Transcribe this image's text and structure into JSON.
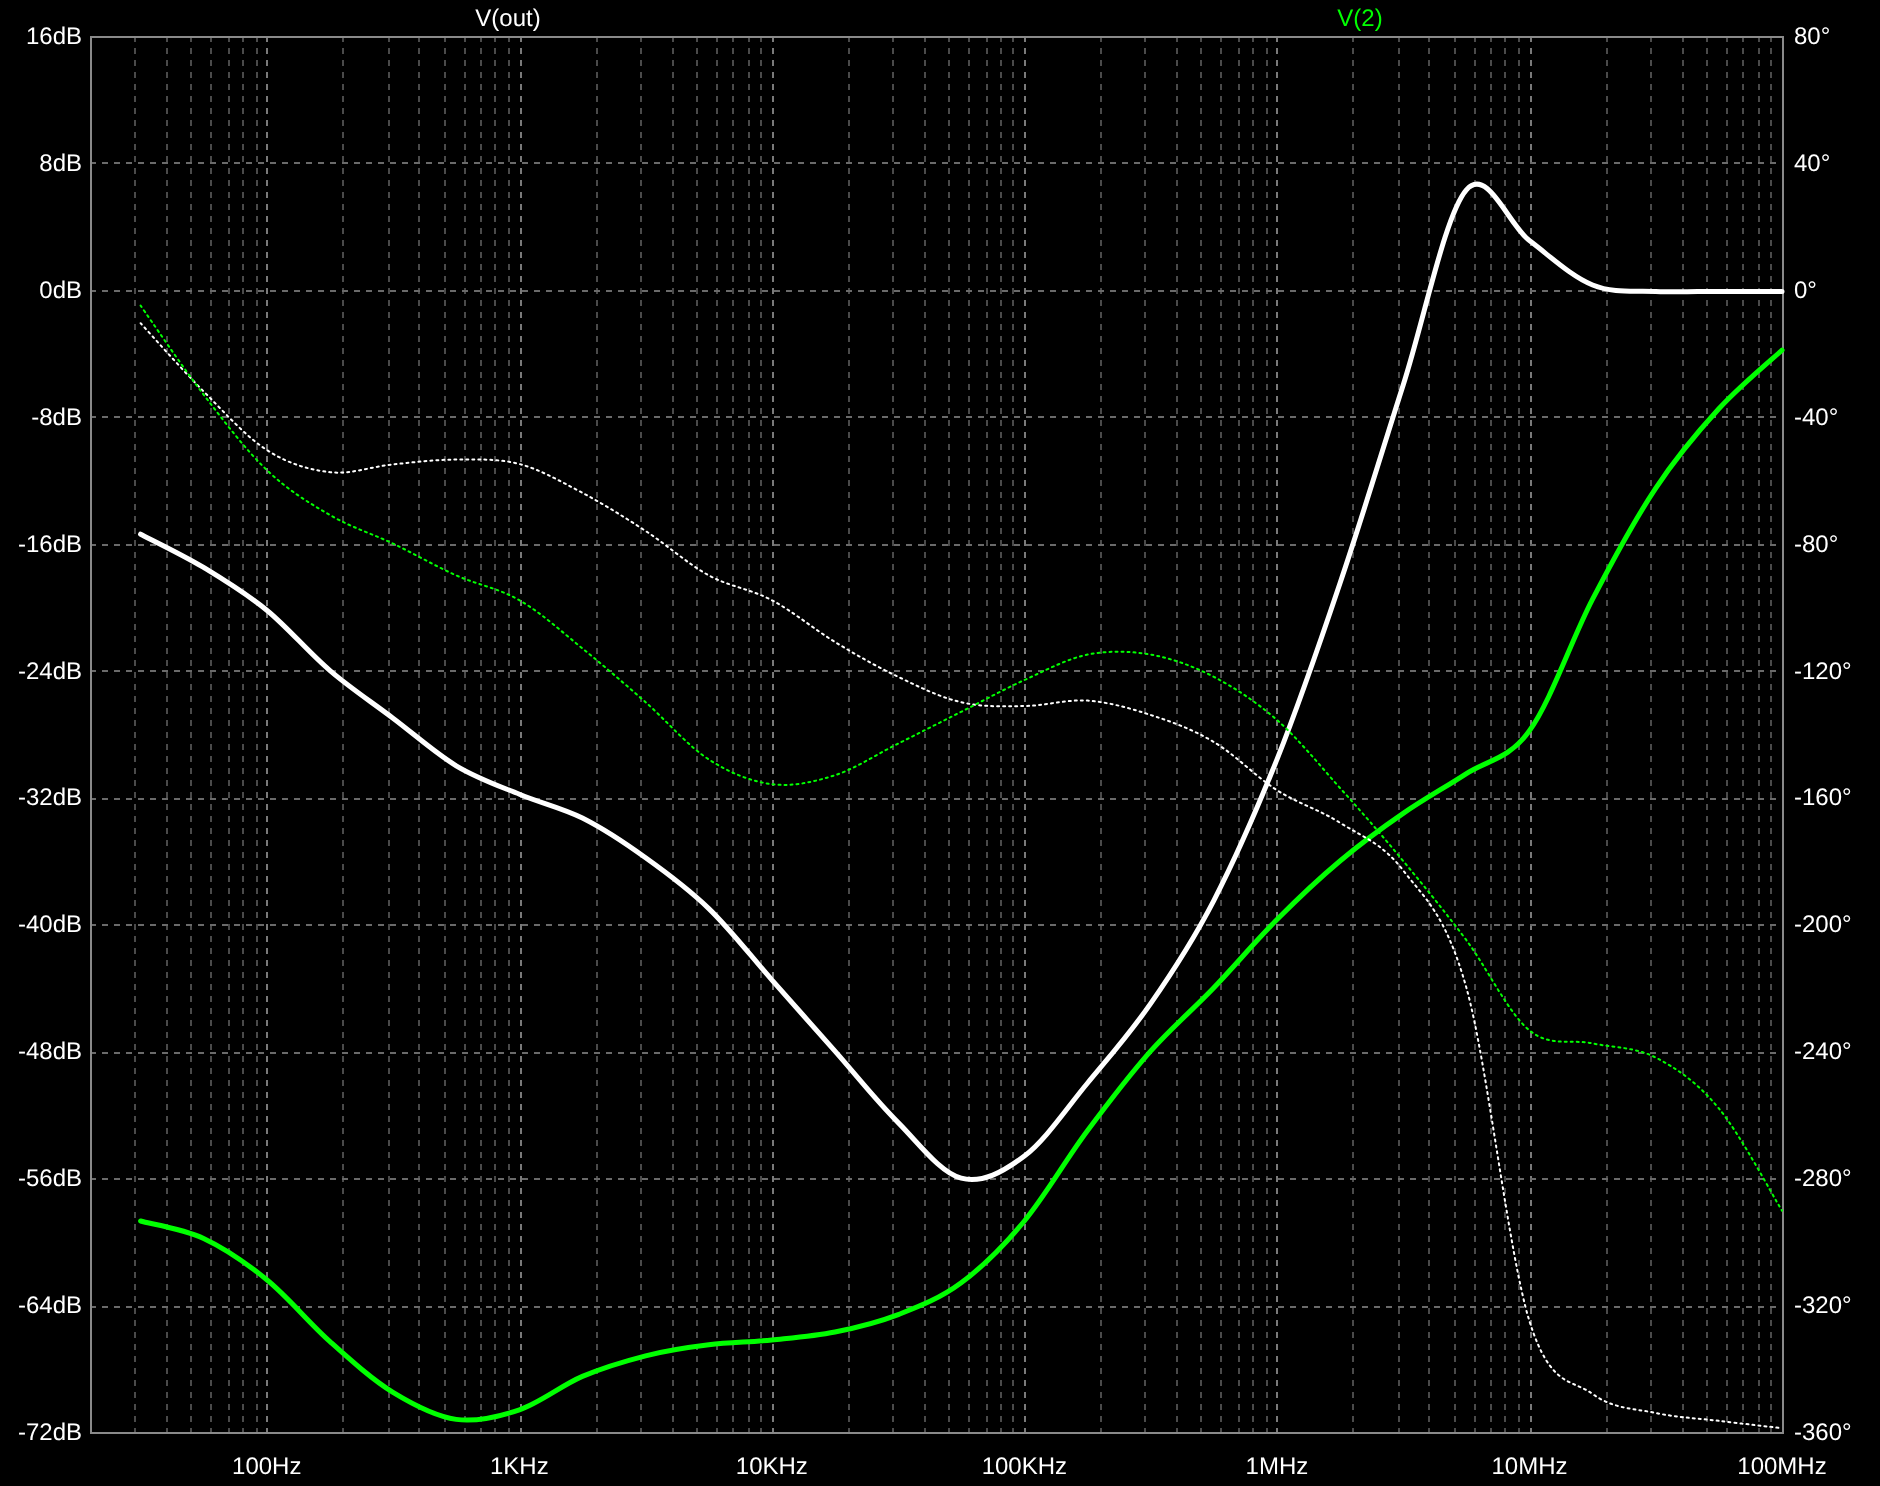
{
  "plot": {
    "chart_data": {
      "type": "line",
      "grid": true,
      "ylim": [
        -72,
        16
      ],
      "y2lim": [
        -360,
        80
      ],
      "categories": [
        null,
        null,
        "100Hz",
        null,
        null,
        null,
        "1KHz",
        null,
        null,
        null,
        "10KHz",
        null,
        null,
        null,
        "100KHz",
        null,
        null,
        null,
        "1MHz",
        null,
        null,
        null,
        "10MHz",
        null,
        null,
        null,
        "100MHz"
      ],
      "yticks": [
        {
          "value": 16,
          "label": "16dB"
        },
        {
          "value": 8,
          "label": "8dB"
        },
        {
          "value": 0,
          "label": "0dB"
        },
        {
          "value": -8,
          "label": "-8dB"
        },
        {
          "value": -16,
          "label": "-16dB"
        },
        {
          "value": -24,
          "label": "-24dB"
        },
        {
          "value": -32,
          "label": "-32dB"
        },
        {
          "value": -40,
          "label": "-40dB"
        },
        {
          "value": -48,
          "label": "-48dB"
        },
        {
          "value": -56,
          "label": "-56dB"
        },
        {
          "value": -64,
          "label": "-64dB"
        },
        {
          "value": -72,
          "label": "-72dB"
        }
      ],
      "y2ticks": [
        {
          "value": 80,
          "label": "80°"
        },
        {
          "value": 40,
          "label": "40°"
        },
        {
          "value": 0,
          "label": "0°"
        },
        {
          "value": -40,
          "label": "-40°"
        },
        {
          "value": -80,
          "label": "-80°"
        },
        {
          "value": -120,
          "label": "-120°"
        },
        {
          "value": -160,
          "label": "-160°"
        },
        {
          "value": -200,
          "label": "-200°"
        },
        {
          "value": -240,
          "label": "-240°"
        },
        {
          "value": -280,
          "label": "-280°"
        },
        {
          "value": -320,
          "label": "-320°"
        },
        {
          "value": -360,
          "label": "-360°"
        }
      ],
      "series": [
        {
          "name": "V(out)",
          "color": "#ffffff",
          "values": [
            -15.4,
            -17.5,
            -20.2,
            -24,
            -27,
            -30,
            -31.8,
            -33.3,
            -35.8,
            -39,
            -43.5,
            -48,
            -52.5,
            -56,
            -54.6,
            -50,
            -45,
            -38.5,
            -29.6,
            -18.5,
            -6,
            6.3,
            3.1,
            0.3,
            -0.1,
            -0.1,
            -0.1
          ]
        },
        {
          "name": "V(2)",
          "color": "#00ff00",
          "values": [
            -58.7,
            -59.8,
            -62.4,
            -66.3,
            -69.5,
            -71.2,
            -70.6,
            -68.5,
            -67.2,
            -66.5,
            -66.2,
            -65.7,
            -64.6,
            -62.6,
            -58.7,
            -53,
            -48,
            -44,
            -39.7,
            -36,
            -33,
            -30.5,
            -27.8,
            -19.5,
            -12.5,
            -7.5,
            -3.8
          ]
        },
        {
          "color": "#ffffff",
          "axis": "y2",
          "line_style": "dotted",
          "values": [
            -10.5,
            -32,
            -50.5,
            -57.5,
            -55,
            -53.5,
            -54.9,
            -64,
            -76,
            -90,
            -97.8,
            -111,
            -122,
            -130,
            -131.2,
            -129.5,
            -134,
            -142.5,
            -157.7,
            -168,
            -183,
            -220,
            -325,
            -348,
            -354,
            -356.5,
            -358.8
          ]
        },
        {
          "color": "#00ff00",
          "axis": "y2",
          "line_style": "dotted",
          "values": [
            -5,
            -33,
            -56.8,
            -71,
            -80,
            -90,
            -97.8,
            -113,
            -130,
            -148,
            -155.8,
            -153,
            -143,
            -133,
            -123,
            -115,
            -115,
            -122,
            -135.6,
            -157,
            -180,
            -205,
            -233.4,
            -237.5,
            -242,
            -258,
            -290.2
          ]
        }
      ]
    }
  }
}
